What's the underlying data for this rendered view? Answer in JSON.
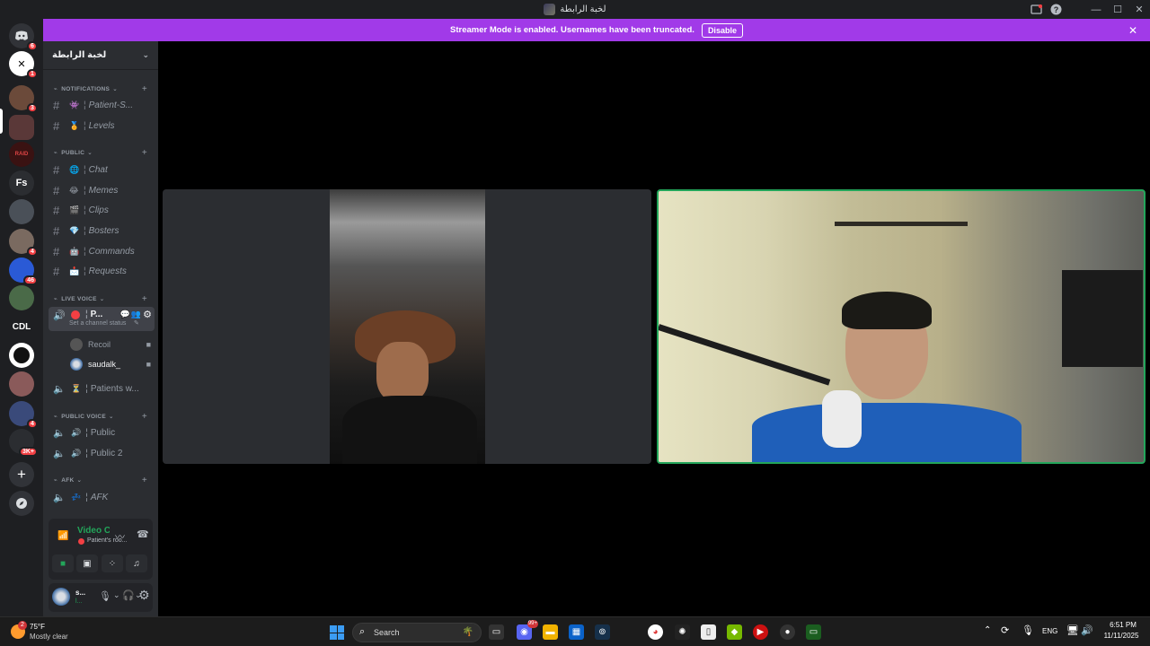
{
  "window": {
    "title": "لخبة الرابطة"
  },
  "banner": {
    "text": "Streamer Mode is enabled. Usernames have been truncated.",
    "button": "Disable"
  },
  "rail": {
    "badges": [
      "6",
      "1",
      "3",
      "4",
      "46",
      "4",
      "3K+"
    ],
    "fs_label": "Fs",
    "cdl_label": "CDL"
  },
  "sidebar": {
    "guild_name": "لخبة الرابطة",
    "categories": {
      "notifications": "NOTIFICATIONS",
      "public": "PUBLIC",
      "live_voice": "LIVE VOICE",
      "public_voice": "PUBLIC VOICE",
      "afk": "AFK"
    },
    "text_channels": [
      {
        "emoji": "👾",
        "name": "Patient-S..."
      },
      {
        "emoji": "🏅",
        "name": "Levels"
      },
      {
        "emoji": "🌐",
        "name": "Chat"
      },
      {
        "emoji": "😂",
        "name": "Memes"
      },
      {
        "emoji": "🎬",
        "name": "Clips"
      },
      {
        "emoji": "💎",
        "name": "Bosters"
      },
      {
        "emoji": "🤖",
        "name": "Commands"
      },
      {
        "emoji": "📩",
        "name": "Requests"
      }
    ],
    "live_channel": {
      "name": "P...",
      "status_hint": "Set a channel status",
      "members": [
        "Recoil",
        "saudalk_"
      ]
    },
    "waiting_channel": "Patients w...",
    "public_voice": [
      "Public",
      "Public 2"
    ],
    "afk_channel": "AFK"
  },
  "voice_panel": {
    "status": "Video Connected",
    "channel": "Patient's roo..."
  },
  "user_panel": {
    "name": "s...",
    "sub": "l..."
  },
  "taskbar": {
    "weather_temp": "75°F",
    "weather_desc": "Mostly clear",
    "weather_badge": "2",
    "search_placeholder": "Search",
    "discord_badge": "99+",
    "lang": "ENG",
    "time": "6:51 PM",
    "date": "11/11/2025"
  }
}
